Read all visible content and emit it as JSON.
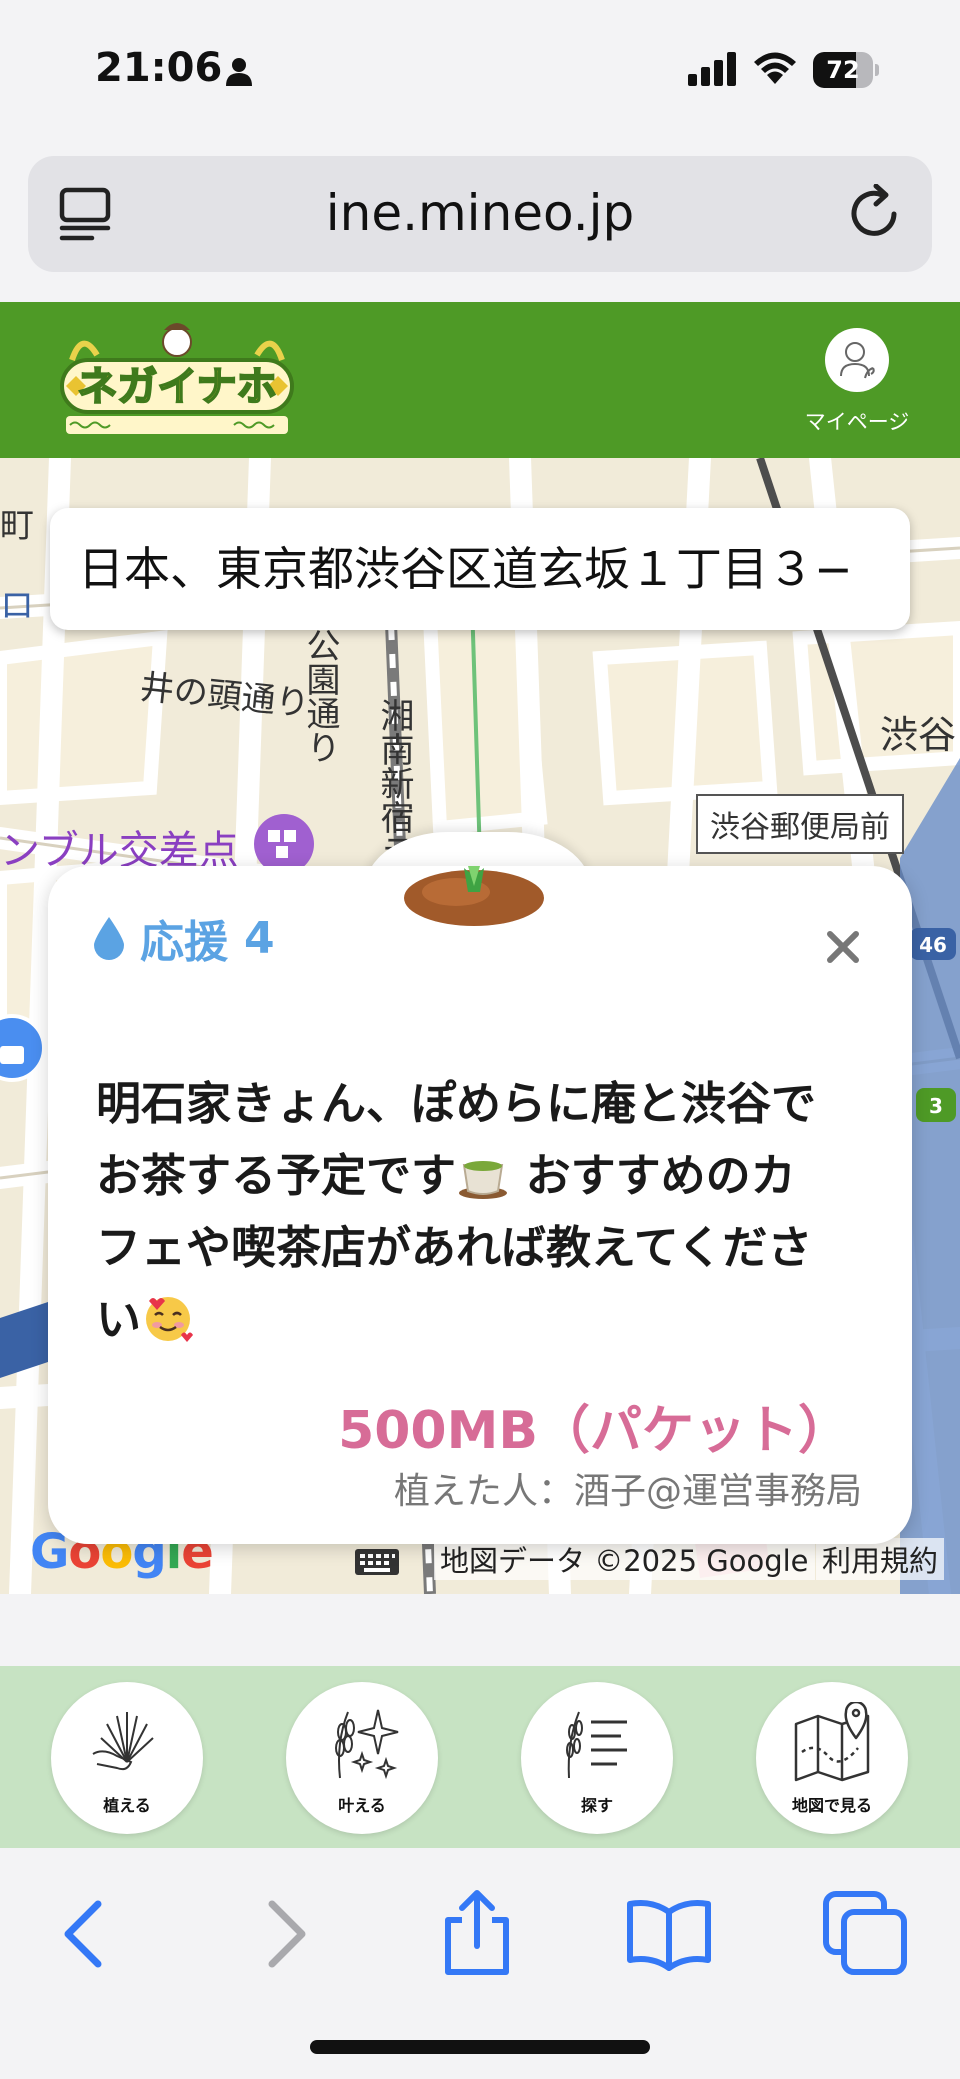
{
  "status_bar": {
    "time": "21:06",
    "battery_percent": "72",
    "battery_level": 0.72
  },
  "browser": {
    "url": "ine.mineo.jp"
  },
  "site_header": {
    "logo_alt": "ネガイナホ",
    "mypage_label": "マイページ"
  },
  "map": {
    "address": "日本、東京都渋谷区道玄坂１丁目３−",
    "labels": {
      "street_inokashira": "井の頭通り",
      "street_koen": "公園通り",
      "shonan": "湘南新宿ラ",
      "crossing": "ンブル交差点",
      "shibuya": "渋谷",
      "post_office": "渋谷郵便局前",
      "cho": "町",
      "ro": "ロ"
    },
    "google_logo": "Google",
    "credit": "地図データ ©2025 Google",
    "terms": "利用規約"
  },
  "card": {
    "support_label": "応援",
    "support_count": "4",
    "message_line1": "明石家きょん、ぽめらに庵と渋谷で",
    "message_line2a": "お茶する予定です",
    "message_line2b": " おすすめのカ",
    "message_line3": "フェや喫茶店があれば教えてくださ",
    "message_line4": "い",
    "amount": "500MB（パケット）",
    "planter": "植えた人：酒子@運営事務局"
  },
  "bottom_nav": {
    "plant": "植える",
    "grant": "叶える",
    "search": "探す",
    "map_view": "地図で見る"
  },
  "colors": {
    "header_green": "#4e9a26",
    "nav_green": "#c7e3c3",
    "support_blue": "#5ba3e3",
    "amount_pink": "#d76c97",
    "safari_blue": "#3478f6"
  }
}
